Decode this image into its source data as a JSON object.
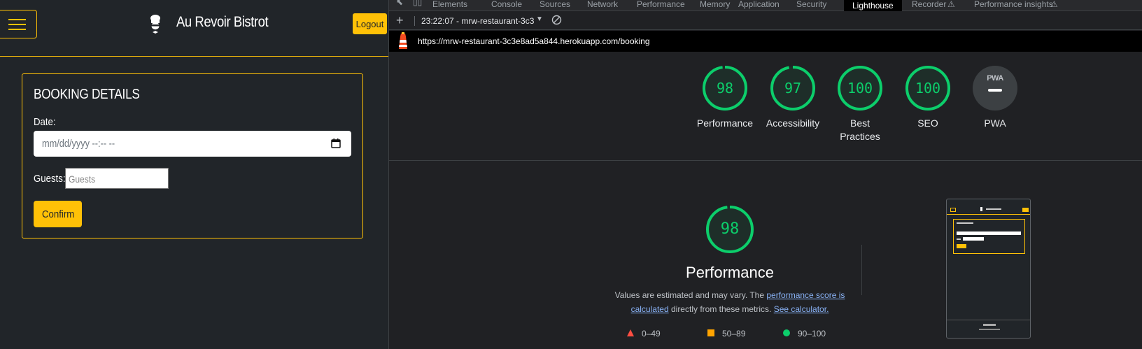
{
  "site": {
    "brand": "Au Revoir Bistrot",
    "logout_label": "Logout",
    "card_title": "BOOKING DETAILS",
    "date_label": "Date:",
    "date_placeholder": "mm/dd/yyyy --:-- --",
    "guests_label": "Guests:",
    "guests_placeholder": "Guests",
    "confirm_label": "Confirm"
  },
  "devtools": {
    "tabs": [
      "Elements",
      "Console",
      "Sources",
      "Network",
      "Performance",
      "Memory",
      "Application",
      "Security",
      "Lighthouse",
      "Recorder",
      "Performance insights"
    ],
    "active_tab": "Lighthouse",
    "session": "23:22:07 - mrw-restaurant-3c3",
    "url": "https://mrw-restaurant-3c3e8ad5a844.herokuapp.com/booking",
    "scores": [
      {
        "label": "Performance",
        "value": "98",
        "fraction": 0.98
      },
      {
        "label": "Accessibility",
        "value": "97",
        "fraction": 0.97
      },
      {
        "label": "Best Practices",
        "value": "100",
        "fraction": 1.0
      },
      {
        "label": "SEO",
        "value": "100",
        "fraction": 1.0
      },
      {
        "label": "PWA",
        "value": "",
        "badge": "PWA"
      }
    ],
    "perf_detail": {
      "value": "98",
      "fraction": 0.98,
      "title": "Performance",
      "desc_prefix": "Values are estimated and may vary. The ",
      "link1": "performance score is calculated",
      "desc_mid": " directly from these metrics. ",
      "link2": "See calculator."
    },
    "legend": [
      {
        "range": "0–49",
        "color": "#ff4e42",
        "shape": "triangle"
      },
      {
        "range": "50–89",
        "color": "#ffa400",
        "shape": "square"
      },
      {
        "range": "90–100",
        "color": "#0cce6b",
        "shape": "circle"
      }
    ],
    "colors": {
      "pass": "#0cce6b",
      "accent": "#ffc107"
    }
  }
}
